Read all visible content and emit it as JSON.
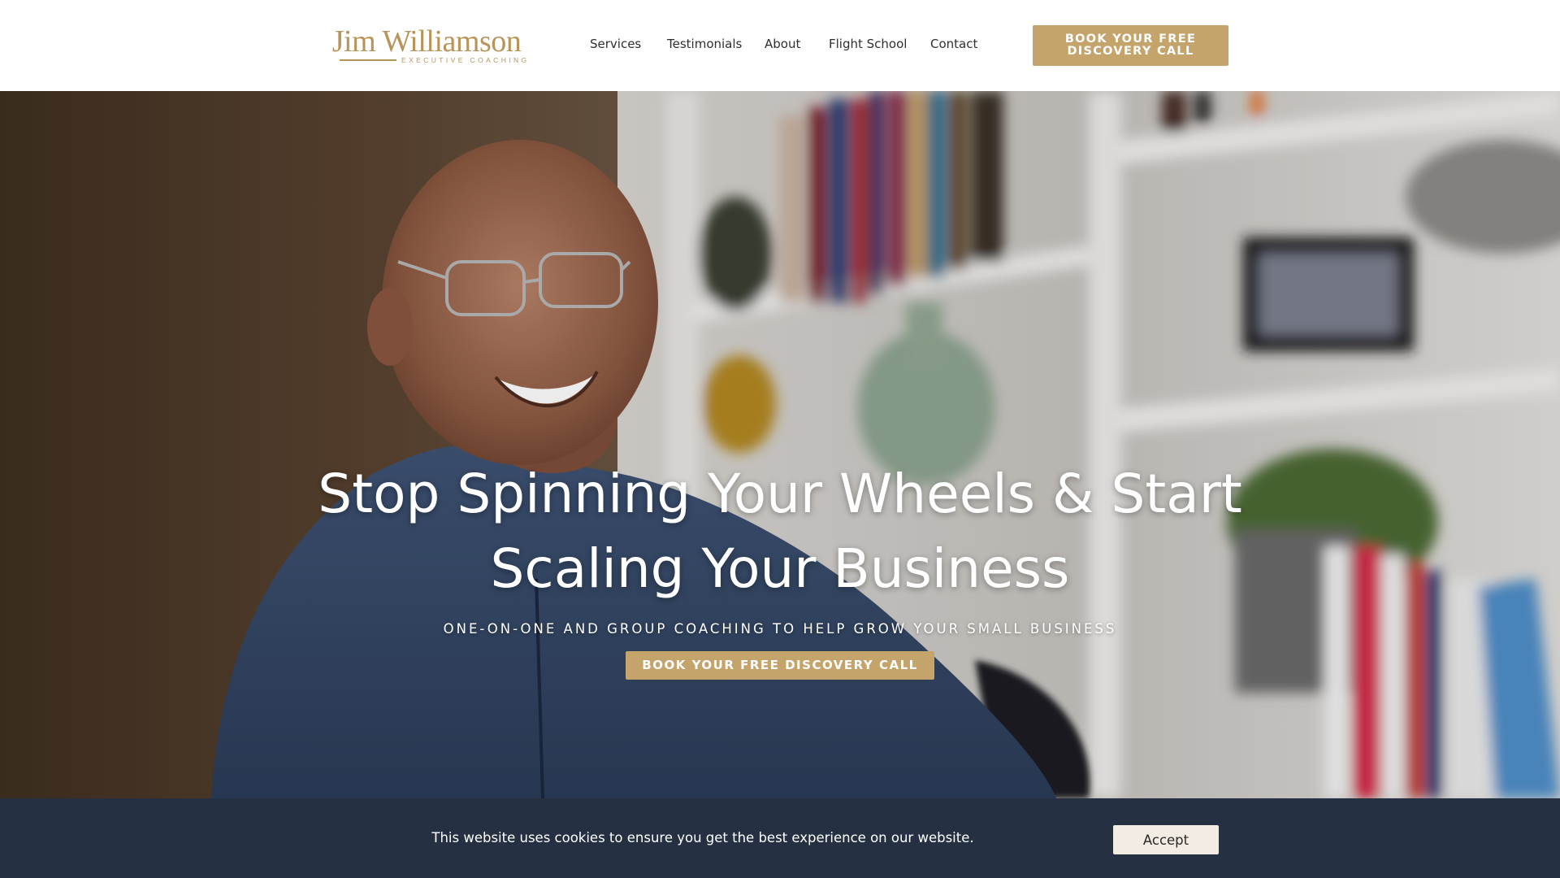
{
  "colors": {
    "accent_gold": "#c5a46b",
    "header_bg": "#ffffff",
    "nav_text": "#2f2f2f",
    "cookie_bar_bg": "#253142",
    "accept_button_bg": "#f2ece2",
    "logo_text": "#b8945a"
  },
  "header": {
    "logo": {
      "name": "Jim Williamson",
      "tagline": "EXECUTIVE COACHING"
    },
    "nav": {
      "items": [
        {
          "label": "Services"
        },
        {
          "label": "Testimonials"
        },
        {
          "label": "About"
        },
        {
          "label": "Flight School"
        },
        {
          "label": "Contact"
        }
      ]
    },
    "cta_label": "BOOK YOUR FREE DISCOVERY CALL"
  },
  "hero": {
    "title": "Stop Spinning Your Wheels & Start Scaling Your Business",
    "subtitle": "ONE-ON-ONE AND GROUP COACHING TO HELP GROW YOUR SMALL BUSINESS",
    "cta_label": "BOOK YOUR FREE DISCOVERY CALL"
  },
  "cookie_banner": {
    "message": "This website uses cookies to ensure you get the best experience on our website.",
    "accept_label": "Accept"
  }
}
